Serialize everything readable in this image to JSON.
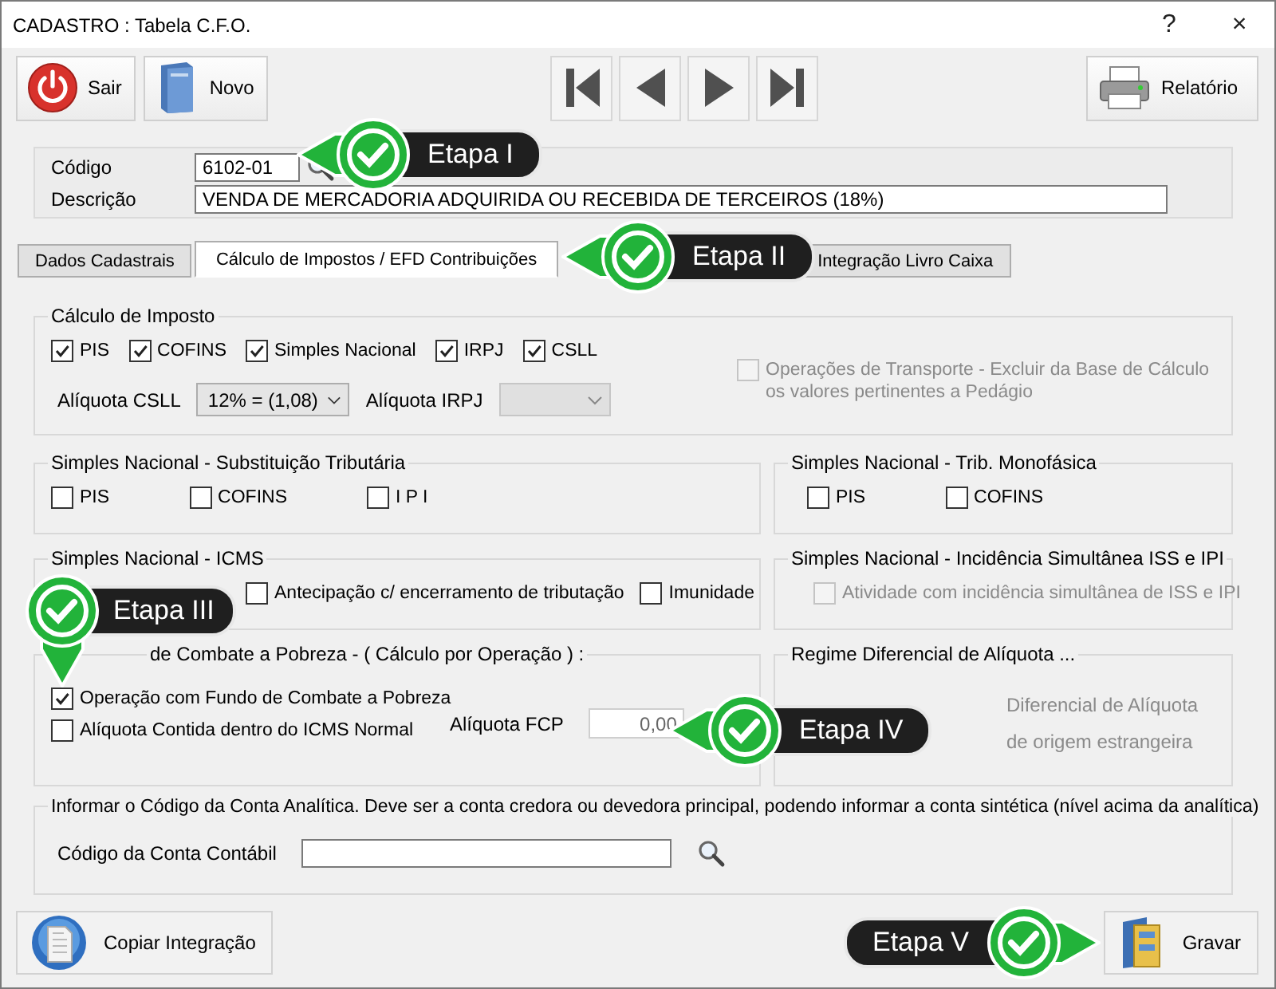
{
  "window": {
    "title": "CADASTRO : Tabela C.F.O.",
    "help": "?",
    "close": "×"
  },
  "toolbar": {
    "left": [
      {
        "label": "Sair"
      },
      {
        "label": "Novo"
      }
    ],
    "right": [
      {
        "label": "Relatório"
      }
    ]
  },
  "header": {
    "code_label": "Código",
    "code_value": "6102-01",
    "description_label": "Descrição",
    "description_value": "VENDA DE MERCADORIA ADQUIRIDA OU RECEBIDA DE TERCEIROS (18%)"
  },
  "tabs": [
    {
      "label": "Dados Cadastrais",
      "selected": false
    },
    {
      "label": "Cálculo de Impostos / EFD Contribuições",
      "selected": true
    },
    {
      "label": "Integração Livro Caixa",
      "selected": false
    }
  ],
  "tax_calc": {
    "title": "Cálculo de Imposto",
    "checks": [
      {
        "label": "PIS",
        "checked": true
      },
      {
        "label": "COFINS",
        "checked": true
      },
      {
        "label": "Simples Nacional",
        "checked": true
      },
      {
        "label": "IRPJ",
        "checked": true
      },
      {
        "label": "CSLL",
        "checked": true
      }
    ],
    "csll_label": "Alíquota CSLL",
    "csll_value": "12% = (1,08)",
    "irpj_label": "Alíquota IRPJ",
    "irpj_disabled": true,
    "transport": {
      "label": "Operações de Transporte - Excluir da Base de Cálculo os valores pertinentes a Pedágio",
      "checked": false,
      "disabled": true
    }
  },
  "st": {
    "title": "Simples Nacional - Substituição Tributária",
    "checks": [
      {
        "label": "PIS",
        "checked": false
      },
      {
        "label": "COFINS",
        "checked": false
      },
      {
        "label": "I P I",
        "checked": false
      }
    ]
  },
  "mono": {
    "title": "Simples Nacional - Trib. Monofásica",
    "checks": [
      {
        "label": "PIS",
        "checked": false
      },
      {
        "label": "COFINS",
        "checked": false
      }
    ]
  },
  "icms": {
    "title": "Simples Nacional - ICMS",
    "checks": [
      {
        "label": "Antecipação c/ encerramento de tributação",
        "checked": false
      },
      {
        "label": "Imunidade",
        "checked": false
      }
    ]
  },
  "iss": {
    "title": "Simples Nacional - Incidência Simultânea ISS e IPI",
    "checks": [
      {
        "label": "Atividade com incidência simultânea de ISS e IPI",
        "checked": false,
        "disabled": true
      }
    ]
  },
  "fcp": {
    "title": "de Combate a Pobreza - ( Cálculo por Operação ) :",
    "checks": [
      {
        "label": "Operação com Fundo de Combate a Pobreza",
        "checked": true
      },
      {
        "label": "Alíquota Contida dentro do ICMS Normal",
        "checked": false
      }
    ],
    "rate_label": "Alíquota FCP",
    "rate_value": "0,00"
  },
  "regime": {
    "title": "Regime Diferencial de Alíquota ...",
    "items": [
      {
        "label": "Diferencial de Alíquota",
        "disabled": true
      },
      {
        "label": "de origem estrangeira",
        "disabled": true
      }
    ]
  },
  "account": {
    "title": "Informar o Código da Conta Analítica. Deve ser a conta credora ou devedora principal, podendo informar a conta sintética (nível acima da analítica)",
    "label": "Código da Conta Contábil"
  },
  "footer": {
    "buttons": [
      {
        "label": "Copiar Integração"
      },
      {
        "label": "Gravar"
      }
    ]
  },
  "callouts": [
    {
      "label": "Etapa I",
      "kind": "left"
    },
    {
      "label": "Etapa II",
      "kind": "left"
    },
    {
      "label": "Etapa III",
      "kind": "down"
    },
    {
      "label": "Etapa IV",
      "kind": "left"
    },
    {
      "label": "Etapa V",
      "kind": "right"
    }
  ]
}
